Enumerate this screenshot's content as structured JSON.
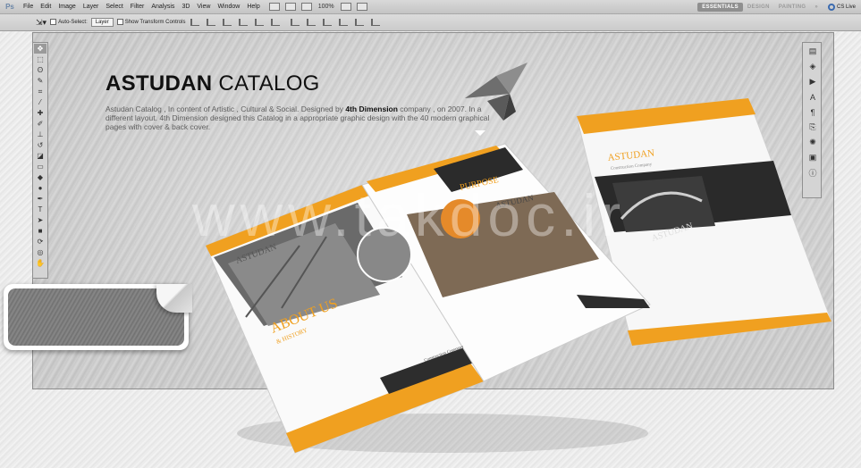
{
  "app": {
    "logo": "Ps"
  },
  "menu": [
    "File",
    "Edit",
    "Image",
    "Layer",
    "Select",
    "Filter",
    "Analysis",
    "3D",
    "View",
    "Window",
    "Help"
  ],
  "menubar": {
    "zoom": "100%"
  },
  "workspaces": [
    "ESSENTIALS",
    "DESIGN",
    "PAINTING"
  ],
  "workspace_more": "»",
  "cs_live": "CS Live",
  "options": {
    "auto_select_label": "Auto-Select:",
    "auto_select_value": "Layer",
    "transform_controls_label": "Show Transform Controls"
  },
  "headline": {
    "bold": "ASTUDAN",
    "light": "CATALOG"
  },
  "description": {
    "part1": "Astudan Catalog , In content of Artistic , Cultural & Social. Designed by ",
    "highlight": "4th Dimension",
    "part2": " company , on 2007. In a different layout. 4th Dimension designed this Catalog in a appropriate graphic design with the 40 modern graphical pages with cover & back cover."
  },
  "watermark": "www.takdoc.ir",
  "brochure": {
    "brand": "ASTUDAN",
    "about_title": "ABOUT US",
    "about_sub": "& HISTORY",
    "purpose_title": "PURPOSE",
    "cover_brand": "ASTUDAN",
    "cover_sub": "Construction Company",
    "footer_label": "Construction Company"
  },
  "colors": {
    "accent_orange": "#f0a020",
    "dark_panel": "#2b2b2b",
    "title": "#111111"
  },
  "tools_left": [
    "move-tool",
    "marquee-tool",
    "lasso-tool",
    "quick-select-tool",
    "crop-tool",
    "eyedropper-tool",
    "healing-tool",
    "brush-tool",
    "clone-stamp-tool",
    "history-brush-tool",
    "eraser-tool",
    "gradient-tool",
    "blur-tool",
    "dodge-tool",
    "pen-tool",
    "type-tool",
    "path-select-tool",
    "shape-tool",
    "3d-rotate-tool",
    "3d-orbit-tool",
    "hand-tool"
  ],
  "tools_right": [
    "layers-panel",
    "color-panel",
    "actions-panel",
    "character-panel",
    "paragraph-panel",
    "clone-source-panel",
    "brush-panel",
    "swatches-panel",
    "info-panel"
  ]
}
